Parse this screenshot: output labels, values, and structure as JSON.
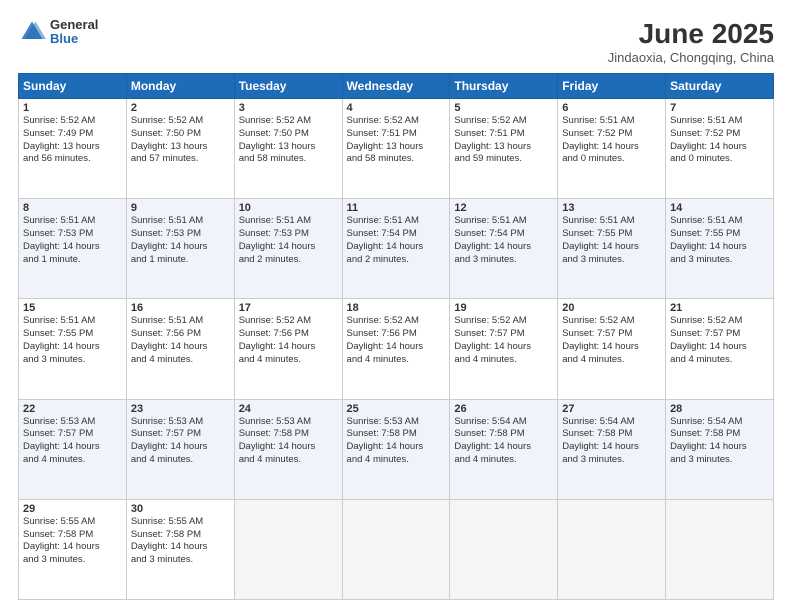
{
  "header": {
    "logo_general": "General",
    "logo_blue": "Blue",
    "month_title": "June 2025",
    "location": "Jindaoxia, Chongqing, China"
  },
  "days_of_week": [
    "Sunday",
    "Monday",
    "Tuesday",
    "Wednesday",
    "Thursday",
    "Friday",
    "Saturday"
  ],
  "weeks": [
    [
      {
        "day": "1",
        "info": "Sunrise: 5:52 AM\nSunset: 7:49 PM\nDaylight: 13 hours\nand 56 minutes."
      },
      {
        "day": "2",
        "info": "Sunrise: 5:52 AM\nSunset: 7:50 PM\nDaylight: 13 hours\nand 57 minutes."
      },
      {
        "day": "3",
        "info": "Sunrise: 5:52 AM\nSunset: 7:50 PM\nDaylight: 13 hours\nand 58 minutes."
      },
      {
        "day": "4",
        "info": "Sunrise: 5:52 AM\nSunset: 7:51 PM\nDaylight: 13 hours\nand 58 minutes."
      },
      {
        "day": "5",
        "info": "Sunrise: 5:52 AM\nSunset: 7:51 PM\nDaylight: 13 hours\nand 59 minutes."
      },
      {
        "day": "6",
        "info": "Sunrise: 5:51 AM\nSunset: 7:52 PM\nDaylight: 14 hours\nand 0 minutes."
      },
      {
        "day": "7",
        "info": "Sunrise: 5:51 AM\nSunset: 7:52 PM\nDaylight: 14 hours\nand 0 minutes."
      }
    ],
    [
      {
        "day": "8",
        "info": "Sunrise: 5:51 AM\nSunset: 7:53 PM\nDaylight: 14 hours\nand 1 minute."
      },
      {
        "day": "9",
        "info": "Sunrise: 5:51 AM\nSunset: 7:53 PM\nDaylight: 14 hours\nand 1 minute."
      },
      {
        "day": "10",
        "info": "Sunrise: 5:51 AM\nSunset: 7:53 PM\nDaylight: 14 hours\nand 2 minutes."
      },
      {
        "day": "11",
        "info": "Sunrise: 5:51 AM\nSunset: 7:54 PM\nDaylight: 14 hours\nand 2 minutes."
      },
      {
        "day": "12",
        "info": "Sunrise: 5:51 AM\nSunset: 7:54 PM\nDaylight: 14 hours\nand 3 minutes."
      },
      {
        "day": "13",
        "info": "Sunrise: 5:51 AM\nSunset: 7:55 PM\nDaylight: 14 hours\nand 3 minutes."
      },
      {
        "day": "14",
        "info": "Sunrise: 5:51 AM\nSunset: 7:55 PM\nDaylight: 14 hours\nand 3 minutes."
      }
    ],
    [
      {
        "day": "15",
        "info": "Sunrise: 5:51 AM\nSunset: 7:55 PM\nDaylight: 14 hours\nand 3 minutes."
      },
      {
        "day": "16",
        "info": "Sunrise: 5:51 AM\nSunset: 7:56 PM\nDaylight: 14 hours\nand 4 minutes."
      },
      {
        "day": "17",
        "info": "Sunrise: 5:52 AM\nSunset: 7:56 PM\nDaylight: 14 hours\nand 4 minutes."
      },
      {
        "day": "18",
        "info": "Sunrise: 5:52 AM\nSunset: 7:56 PM\nDaylight: 14 hours\nand 4 minutes."
      },
      {
        "day": "19",
        "info": "Sunrise: 5:52 AM\nSunset: 7:57 PM\nDaylight: 14 hours\nand 4 minutes."
      },
      {
        "day": "20",
        "info": "Sunrise: 5:52 AM\nSunset: 7:57 PM\nDaylight: 14 hours\nand 4 minutes."
      },
      {
        "day": "21",
        "info": "Sunrise: 5:52 AM\nSunset: 7:57 PM\nDaylight: 14 hours\nand 4 minutes."
      }
    ],
    [
      {
        "day": "22",
        "info": "Sunrise: 5:53 AM\nSunset: 7:57 PM\nDaylight: 14 hours\nand 4 minutes."
      },
      {
        "day": "23",
        "info": "Sunrise: 5:53 AM\nSunset: 7:57 PM\nDaylight: 14 hours\nand 4 minutes."
      },
      {
        "day": "24",
        "info": "Sunrise: 5:53 AM\nSunset: 7:58 PM\nDaylight: 14 hours\nand 4 minutes."
      },
      {
        "day": "25",
        "info": "Sunrise: 5:53 AM\nSunset: 7:58 PM\nDaylight: 14 hours\nand 4 minutes."
      },
      {
        "day": "26",
        "info": "Sunrise: 5:54 AM\nSunset: 7:58 PM\nDaylight: 14 hours\nand 4 minutes."
      },
      {
        "day": "27",
        "info": "Sunrise: 5:54 AM\nSunset: 7:58 PM\nDaylight: 14 hours\nand 3 minutes."
      },
      {
        "day": "28",
        "info": "Sunrise: 5:54 AM\nSunset: 7:58 PM\nDaylight: 14 hours\nand 3 minutes."
      }
    ],
    [
      {
        "day": "29",
        "info": "Sunrise: 5:55 AM\nSunset: 7:58 PM\nDaylight: 14 hours\nand 3 minutes."
      },
      {
        "day": "30",
        "info": "Sunrise: 5:55 AM\nSunset: 7:58 PM\nDaylight: 14 hours\nand 3 minutes."
      },
      {
        "day": "",
        "info": ""
      },
      {
        "day": "",
        "info": ""
      },
      {
        "day": "",
        "info": ""
      },
      {
        "day": "",
        "info": ""
      },
      {
        "day": "",
        "info": ""
      }
    ]
  ]
}
